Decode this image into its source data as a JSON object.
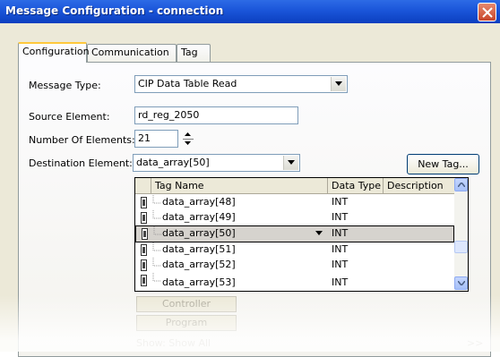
{
  "window": {
    "title": "Message Configuration - connection"
  },
  "tabs": [
    {
      "label": "Configuration",
      "active": true
    },
    {
      "label": "Communication",
      "active": false
    },
    {
      "label": "Tag",
      "active": false
    }
  ],
  "form": {
    "message_type_label": "Message Type:",
    "message_type_value": "CIP Data Table Read",
    "source_label": "Source Element:",
    "source_value": "rd_reg_2050",
    "num_elements_label": "Number Of Elements:",
    "num_elements_value": "21",
    "dest_label": "Destination Element:",
    "dest_value": "data_array[50]",
    "new_tag_label": "New Tag..."
  },
  "grid": {
    "columns": [
      "Tag Name",
      "Data Type",
      "Description"
    ],
    "rows": [
      {
        "name": "data_array[48]",
        "type": "INT",
        "selected": false
      },
      {
        "name": "data_array[49]",
        "type": "INT",
        "selected": false
      },
      {
        "name": "data_array[50]",
        "type": "INT",
        "selected": true
      },
      {
        "name": "data_array[51]",
        "type": "INT",
        "selected": false
      },
      {
        "name": "data_array[52]",
        "type": "INT",
        "selected": false
      },
      {
        "name": "data_array[53]",
        "type": "INT",
        "selected": false
      }
    ]
  },
  "scope_buttons": {
    "controller": "Controller",
    "program": "Program"
  },
  "show_filter": "Show: Show All",
  "more_button": ">>",
  "colors": {
    "title_bar": "#0b3fbf",
    "selected_row": "#d6d3ce",
    "tab_highlight": "#ffc83c"
  },
  "icons": [
    "close-icon",
    "dropdown-arrow-icon",
    "spinner-up-icon",
    "spinner-down-icon",
    "tag-icon",
    "scroll-up-icon",
    "scroll-down-icon"
  ]
}
